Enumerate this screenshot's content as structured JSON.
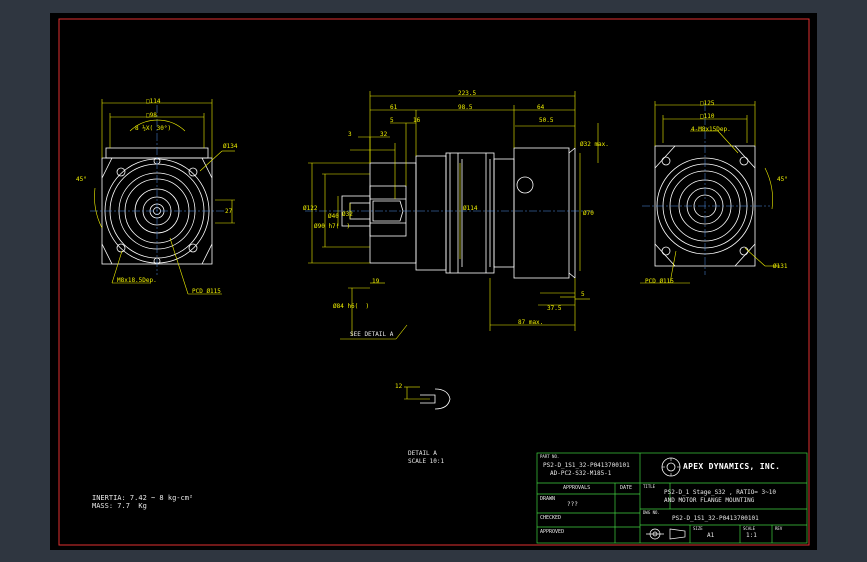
{
  "drawing": {
    "views": {
      "left": {
        "square": "□114",
        "inner_square": "□98",
        "bolt_angle": "8 ½X( 30°)",
        "bore": "Ø134",
        "angle": "45°",
        "side_dim": "27",
        "holes": "M8x18.5Dep.",
        "pcd": "PCD Ø115"
      },
      "side": {
        "overall": "223.5",
        "d61": "61",
        "d985": "98.5",
        "d64": "64",
        "d505": "50.5",
        "d5": "5",
        "d16": "16",
        "d3": "3",
        "d32": "32",
        "dia122": "Ø122",
        "dia90h7": "Ø90 h7(  )",
        "dia40": "Ø40",
        "dia32": "Ø32",
        "dia114": "Ø114",
        "dia70": "Ø70",
        "dia32max": "Ø32 max.",
        "d19": "19",
        "d375": "37.5",
        "d5b": "5",
        "d87": "87 max.",
        "dia84": "Ø84 h6(  )",
        "see_detail": "SEE DETAIL A"
      },
      "right": {
        "square": "□125",
        "inner_square": "□110",
        "holes": "4-M8x15Dep.",
        "angle": "45°",
        "pcd": "PCD Ø115",
        "bore": "Ø131"
      },
      "detail": {
        "dim": "12",
        "title": "DETAIL A",
        "scale": "SCALE 10:1"
      }
    },
    "notes": {
      "inertia": "INERTIA: 7.42 ~ 8 kg-cm²",
      "mass": "MASS: 7.7  Kg"
    },
    "title_block": {
      "part_no_label": "PART NO.",
      "part_no_1": "PS2-D_1S1_32-P0413700101",
      "part_no_2": "AD-PC2-S32-M185-1",
      "approvals": "APPROVALS",
      "date": "DATE",
      "drawn": "DRAWN",
      "drawn_value": "???",
      "checked": "CHECKED",
      "approved": "APPROVED",
      "company": "APEX DYNAMICS, INC.",
      "title_label": "TITLE",
      "title_1": "PS2-D_1 Stage_S32 , RATIO= 3~10",
      "title_2": "AND MOTOR FLANGE MOUNTING",
      "dwg_label": "DWG NO.",
      "dwg_no": "PS2-D_1S1_32-P0413700101",
      "size_label": "SIZE",
      "size": "A1",
      "scale_label": "SCALE",
      "scale": "1:1",
      "rev_label": "REV"
    },
    "colors": {
      "background": "#000000",
      "border": "#e03030",
      "geometry": "#ffffff",
      "dimension": "#f0f000",
      "center": "#4f8fe6",
      "title_block": "#40d040"
    }
  }
}
